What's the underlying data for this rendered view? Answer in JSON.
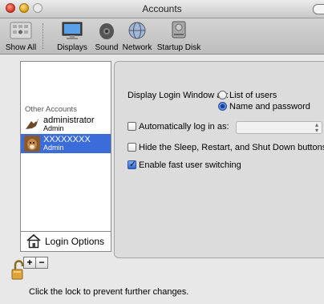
{
  "window": {
    "title": "Accounts"
  },
  "toolbar": {
    "items": [
      {
        "label": "Show All",
        "icon": "apple-grid-icon"
      },
      {
        "label": "Displays",
        "icon": "display-icon"
      },
      {
        "label": "Sound",
        "icon": "speaker-icon"
      },
      {
        "label": "Network",
        "icon": "globe-icon"
      },
      {
        "label": "Startup Disk",
        "icon": "hard-disk-icon"
      }
    ]
  },
  "accounts": {
    "section_label": "Other Accounts",
    "items": [
      {
        "name": "administrator",
        "role": "Admin",
        "selected": false
      },
      {
        "name": "XXXXXXXX",
        "role": "Admin",
        "selected": true
      }
    ],
    "login_options_label": "Login Options",
    "add_label": "+",
    "remove_label": "−"
  },
  "login": {
    "display_label": "Display Login Window as:",
    "option_list": "List of users",
    "option_name": "Name and password",
    "selected_option": "Name and password",
    "auto_login_label": "Automatically log in as:",
    "auto_login_checked": false,
    "auto_login_value": "",
    "hide_buttons_label": "Hide the Sleep, Restart, and Shut Down buttons",
    "hide_buttons_checked": false,
    "fast_switch_label": "Enable fast user switching",
    "fast_switch_checked": true
  },
  "footer": {
    "lock_text": "Click the lock to prevent further changes."
  },
  "colors": {
    "selection": "#3b6cd9",
    "window_bg": "#e8e8e8"
  }
}
